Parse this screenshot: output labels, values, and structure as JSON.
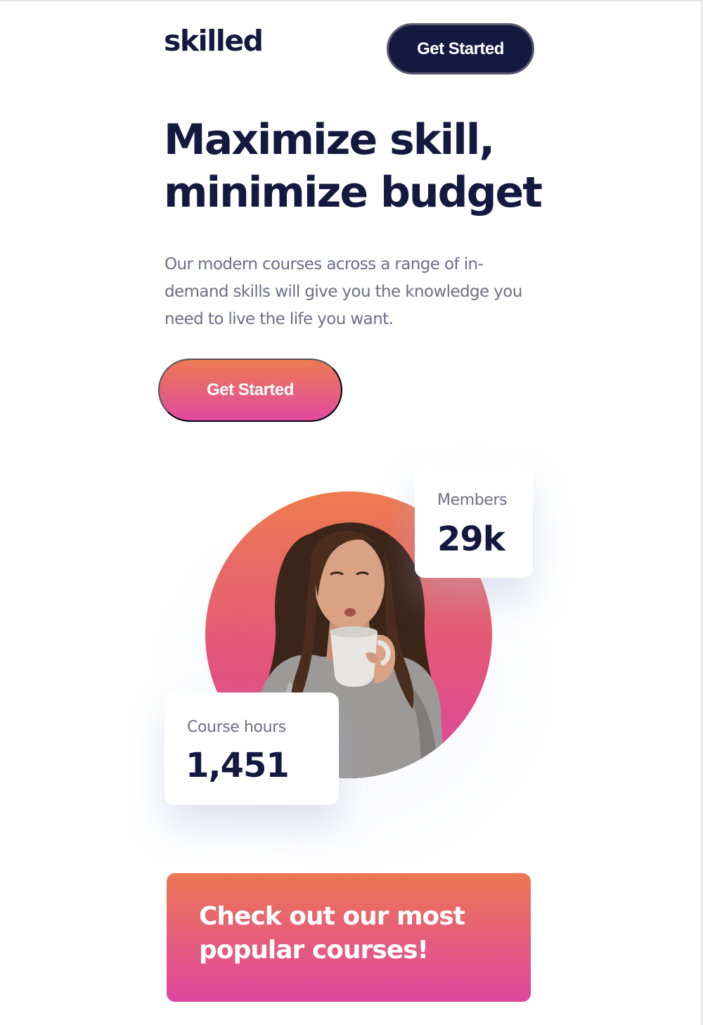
{
  "header": {
    "logo": "skilled",
    "cta_label": "Get Started"
  },
  "hero": {
    "title_line_1": "Maximize skill,",
    "title_line_2": "minimize budget",
    "description": "Our modern courses across a range of in-demand skills will give you the knowledge you need to live the life you want.",
    "cta_label": "Get Started",
    "image_icon": "woman-drinking-coffee-photo"
  },
  "stats": {
    "members": {
      "label": "Members",
      "value": "29k"
    },
    "course_hours": {
      "label": "Course hours",
      "value": "1,451"
    }
  },
  "promo": {
    "line_1": "Check out our most",
    "line_2": "popular courses!"
  },
  "colors": {
    "navy": "#141a3f",
    "gradient_start": "#ed7a52",
    "gradient_end": "#df45a0",
    "muted_text": "#6c6e86"
  }
}
